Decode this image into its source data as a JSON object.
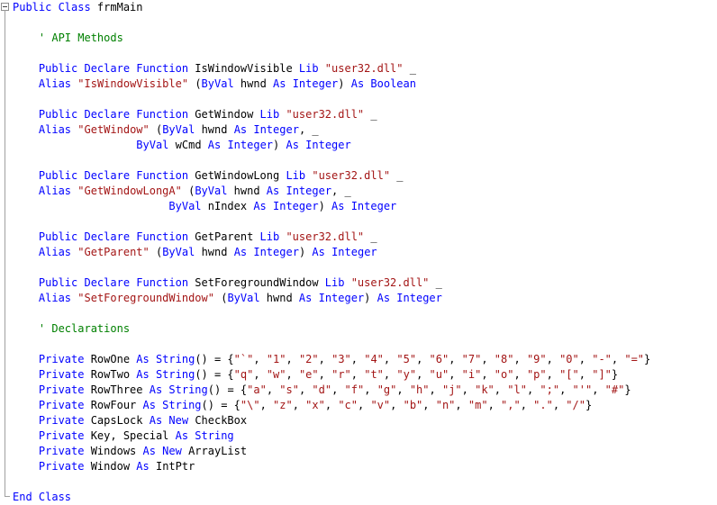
{
  "colors": {
    "keyword": "#0000ff",
    "string": "#a31515",
    "comment": "#008000",
    "plain": "#000000",
    "background": "#ffffff"
  },
  "lines": [
    [
      {
        "t": "kw",
        "v": "Public Class "
      },
      {
        "t": "p",
        "v": "frmMain"
      }
    ],
    [],
    [
      {
        "t": "p",
        "v": "    "
      },
      {
        "t": "cm",
        "v": "' API Methods"
      }
    ],
    [],
    [
      {
        "t": "p",
        "v": "    "
      },
      {
        "t": "kw",
        "v": "Public Declare Function "
      },
      {
        "t": "p",
        "v": "IsWindowVisible "
      },
      {
        "t": "kw",
        "v": "Lib "
      },
      {
        "t": "str",
        "v": "\"user32.dll\""
      },
      {
        "t": "p",
        "v": " _"
      }
    ],
    [
      {
        "t": "p",
        "v": "    "
      },
      {
        "t": "kw",
        "v": "Alias "
      },
      {
        "t": "str",
        "v": "\"IsWindowVisible\""
      },
      {
        "t": "p",
        "v": " ("
      },
      {
        "t": "kw",
        "v": "ByVal "
      },
      {
        "t": "p",
        "v": "hwnd "
      },
      {
        "t": "kw",
        "v": "As Integer"
      },
      {
        "t": "p",
        "v": ") "
      },
      {
        "t": "kw",
        "v": "As Boolean"
      }
    ],
    [],
    [
      {
        "t": "p",
        "v": "    "
      },
      {
        "t": "kw",
        "v": "Public Declare Function "
      },
      {
        "t": "p",
        "v": "GetWindow "
      },
      {
        "t": "kw",
        "v": "Lib "
      },
      {
        "t": "str",
        "v": "\"user32.dll\""
      },
      {
        "t": "p",
        "v": " _"
      }
    ],
    [
      {
        "t": "p",
        "v": "    "
      },
      {
        "t": "kw",
        "v": "Alias "
      },
      {
        "t": "str",
        "v": "\"GetWindow\""
      },
      {
        "t": "p",
        "v": " ("
      },
      {
        "t": "kw",
        "v": "ByVal "
      },
      {
        "t": "p",
        "v": "hwnd "
      },
      {
        "t": "kw",
        "v": "As Integer"
      },
      {
        "t": "p",
        "v": ", _"
      }
    ],
    [
      {
        "t": "p",
        "v": "                   "
      },
      {
        "t": "kw",
        "v": "ByVal "
      },
      {
        "t": "p",
        "v": "wCmd "
      },
      {
        "t": "kw",
        "v": "As Integer"
      },
      {
        "t": "p",
        "v": ") "
      },
      {
        "t": "kw",
        "v": "As Integer"
      }
    ],
    [],
    [
      {
        "t": "p",
        "v": "    "
      },
      {
        "t": "kw",
        "v": "Public Declare Function "
      },
      {
        "t": "p",
        "v": "GetWindowLong "
      },
      {
        "t": "kw",
        "v": "Lib "
      },
      {
        "t": "str",
        "v": "\"user32.dll\""
      },
      {
        "t": "p",
        "v": " _"
      }
    ],
    [
      {
        "t": "p",
        "v": "    "
      },
      {
        "t": "kw",
        "v": "Alias "
      },
      {
        "t": "str",
        "v": "\"GetWindowLongA\""
      },
      {
        "t": "p",
        "v": " ("
      },
      {
        "t": "kw",
        "v": "ByVal "
      },
      {
        "t": "p",
        "v": "hwnd "
      },
      {
        "t": "kw",
        "v": "As Integer"
      },
      {
        "t": "p",
        "v": ", _"
      }
    ],
    [
      {
        "t": "p",
        "v": "                        "
      },
      {
        "t": "kw",
        "v": "ByVal "
      },
      {
        "t": "p",
        "v": "nIndex "
      },
      {
        "t": "kw",
        "v": "As Integer"
      },
      {
        "t": "p",
        "v": ") "
      },
      {
        "t": "kw",
        "v": "As Integer"
      }
    ],
    [],
    [
      {
        "t": "p",
        "v": "    "
      },
      {
        "t": "kw",
        "v": "Public Declare Function "
      },
      {
        "t": "p",
        "v": "GetParent "
      },
      {
        "t": "kw",
        "v": "Lib "
      },
      {
        "t": "str",
        "v": "\"user32.dll\""
      },
      {
        "t": "p",
        "v": " _"
      }
    ],
    [
      {
        "t": "p",
        "v": "    "
      },
      {
        "t": "kw",
        "v": "Alias "
      },
      {
        "t": "str",
        "v": "\"GetParent\""
      },
      {
        "t": "p",
        "v": " ("
      },
      {
        "t": "kw",
        "v": "ByVal "
      },
      {
        "t": "p",
        "v": "hwnd "
      },
      {
        "t": "kw",
        "v": "As Integer"
      },
      {
        "t": "p",
        "v": ") "
      },
      {
        "t": "kw",
        "v": "As Integer"
      }
    ],
    [],
    [
      {
        "t": "p",
        "v": "    "
      },
      {
        "t": "kw",
        "v": "Public Declare Function "
      },
      {
        "t": "p",
        "v": "SetForegroundWindow "
      },
      {
        "t": "kw",
        "v": "Lib "
      },
      {
        "t": "str",
        "v": "\"user32.dll\""
      },
      {
        "t": "p",
        "v": " _"
      }
    ],
    [
      {
        "t": "p",
        "v": "    "
      },
      {
        "t": "kw",
        "v": "Alias "
      },
      {
        "t": "str",
        "v": "\"SetForegroundWindow\""
      },
      {
        "t": "p",
        "v": " ("
      },
      {
        "t": "kw",
        "v": "ByVal "
      },
      {
        "t": "p",
        "v": "hwnd "
      },
      {
        "t": "kw",
        "v": "As Integer"
      },
      {
        "t": "p",
        "v": ") "
      },
      {
        "t": "kw",
        "v": "As Integer"
      }
    ],
    [],
    [
      {
        "t": "p",
        "v": "    "
      },
      {
        "t": "cm",
        "v": "' Declarations"
      }
    ],
    [],
    [
      {
        "t": "p",
        "v": "    "
      },
      {
        "t": "kw",
        "v": "Private "
      },
      {
        "t": "p",
        "v": "RowOne "
      },
      {
        "t": "kw",
        "v": "As String"
      },
      {
        "t": "p",
        "v": "() = {"
      },
      {
        "t": "str",
        "v": "\"`\""
      },
      {
        "t": "p",
        "v": ", "
      },
      {
        "t": "str",
        "v": "\"1\""
      },
      {
        "t": "p",
        "v": ", "
      },
      {
        "t": "str",
        "v": "\"2\""
      },
      {
        "t": "p",
        "v": ", "
      },
      {
        "t": "str",
        "v": "\"3\""
      },
      {
        "t": "p",
        "v": ", "
      },
      {
        "t": "str",
        "v": "\"4\""
      },
      {
        "t": "p",
        "v": ", "
      },
      {
        "t": "str",
        "v": "\"5\""
      },
      {
        "t": "p",
        "v": ", "
      },
      {
        "t": "str",
        "v": "\"6\""
      },
      {
        "t": "p",
        "v": ", "
      },
      {
        "t": "str",
        "v": "\"7\""
      },
      {
        "t": "p",
        "v": ", "
      },
      {
        "t": "str",
        "v": "\"8\""
      },
      {
        "t": "p",
        "v": ", "
      },
      {
        "t": "str",
        "v": "\"9\""
      },
      {
        "t": "p",
        "v": ", "
      },
      {
        "t": "str",
        "v": "\"0\""
      },
      {
        "t": "p",
        "v": ", "
      },
      {
        "t": "str",
        "v": "\"-\""
      },
      {
        "t": "p",
        "v": ", "
      },
      {
        "t": "str",
        "v": "\"=\""
      },
      {
        "t": "p",
        "v": "}"
      }
    ],
    [
      {
        "t": "p",
        "v": "    "
      },
      {
        "t": "kw",
        "v": "Private "
      },
      {
        "t": "p",
        "v": "RowTwo "
      },
      {
        "t": "kw",
        "v": "As String"
      },
      {
        "t": "p",
        "v": "() = {"
      },
      {
        "t": "str",
        "v": "\"q\""
      },
      {
        "t": "p",
        "v": ", "
      },
      {
        "t": "str",
        "v": "\"w\""
      },
      {
        "t": "p",
        "v": ", "
      },
      {
        "t": "str",
        "v": "\"e\""
      },
      {
        "t": "p",
        "v": ", "
      },
      {
        "t": "str",
        "v": "\"r\""
      },
      {
        "t": "p",
        "v": ", "
      },
      {
        "t": "str",
        "v": "\"t\""
      },
      {
        "t": "p",
        "v": ", "
      },
      {
        "t": "str",
        "v": "\"y\""
      },
      {
        "t": "p",
        "v": ", "
      },
      {
        "t": "str",
        "v": "\"u\""
      },
      {
        "t": "p",
        "v": ", "
      },
      {
        "t": "str",
        "v": "\"i\""
      },
      {
        "t": "p",
        "v": ", "
      },
      {
        "t": "str",
        "v": "\"o\""
      },
      {
        "t": "p",
        "v": ", "
      },
      {
        "t": "str",
        "v": "\"p\""
      },
      {
        "t": "p",
        "v": ", "
      },
      {
        "t": "str",
        "v": "\"[\""
      },
      {
        "t": "p",
        "v": ", "
      },
      {
        "t": "str",
        "v": "\"]\""
      },
      {
        "t": "p",
        "v": "}"
      }
    ],
    [
      {
        "t": "p",
        "v": "    "
      },
      {
        "t": "kw",
        "v": "Private "
      },
      {
        "t": "p",
        "v": "RowThree "
      },
      {
        "t": "kw",
        "v": "As String"
      },
      {
        "t": "p",
        "v": "() = {"
      },
      {
        "t": "str",
        "v": "\"a\""
      },
      {
        "t": "p",
        "v": ", "
      },
      {
        "t": "str",
        "v": "\"s\""
      },
      {
        "t": "p",
        "v": ", "
      },
      {
        "t": "str",
        "v": "\"d\""
      },
      {
        "t": "p",
        "v": ", "
      },
      {
        "t": "str",
        "v": "\"f\""
      },
      {
        "t": "p",
        "v": ", "
      },
      {
        "t": "str",
        "v": "\"g\""
      },
      {
        "t": "p",
        "v": ", "
      },
      {
        "t": "str",
        "v": "\"h\""
      },
      {
        "t": "p",
        "v": ", "
      },
      {
        "t": "str",
        "v": "\"j\""
      },
      {
        "t": "p",
        "v": ", "
      },
      {
        "t": "str",
        "v": "\"k\""
      },
      {
        "t": "p",
        "v": ", "
      },
      {
        "t": "str",
        "v": "\"l\""
      },
      {
        "t": "p",
        "v": ", "
      },
      {
        "t": "str",
        "v": "\";\""
      },
      {
        "t": "p",
        "v": ", "
      },
      {
        "t": "str",
        "v": "\"'\""
      },
      {
        "t": "p",
        "v": ", "
      },
      {
        "t": "str",
        "v": "\"#\""
      },
      {
        "t": "p",
        "v": "}"
      }
    ],
    [
      {
        "t": "p",
        "v": "    "
      },
      {
        "t": "kw",
        "v": "Private "
      },
      {
        "t": "p",
        "v": "RowFour "
      },
      {
        "t": "kw",
        "v": "As String"
      },
      {
        "t": "p",
        "v": "() = {"
      },
      {
        "t": "str",
        "v": "\"\\\""
      },
      {
        "t": "p",
        "v": ", "
      },
      {
        "t": "str",
        "v": "\"z\""
      },
      {
        "t": "p",
        "v": ", "
      },
      {
        "t": "str",
        "v": "\"x\""
      },
      {
        "t": "p",
        "v": ", "
      },
      {
        "t": "str",
        "v": "\"c\""
      },
      {
        "t": "p",
        "v": ", "
      },
      {
        "t": "str",
        "v": "\"v\""
      },
      {
        "t": "p",
        "v": ", "
      },
      {
        "t": "str",
        "v": "\"b\""
      },
      {
        "t": "p",
        "v": ", "
      },
      {
        "t": "str",
        "v": "\"n\""
      },
      {
        "t": "p",
        "v": ", "
      },
      {
        "t": "str",
        "v": "\"m\""
      },
      {
        "t": "p",
        "v": ", "
      },
      {
        "t": "str",
        "v": "\",\""
      },
      {
        "t": "p",
        "v": ", "
      },
      {
        "t": "str",
        "v": "\".\""
      },
      {
        "t": "p",
        "v": ", "
      },
      {
        "t": "str",
        "v": "\"/\""
      },
      {
        "t": "p",
        "v": "}"
      }
    ],
    [
      {
        "t": "p",
        "v": "    "
      },
      {
        "t": "kw",
        "v": "Private "
      },
      {
        "t": "p",
        "v": "CapsLock "
      },
      {
        "t": "kw",
        "v": "As New "
      },
      {
        "t": "p",
        "v": "CheckBox"
      }
    ],
    [
      {
        "t": "p",
        "v": "    "
      },
      {
        "t": "kw",
        "v": "Private "
      },
      {
        "t": "p",
        "v": "Key, Special "
      },
      {
        "t": "kw",
        "v": "As String"
      }
    ],
    [
      {
        "t": "p",
        "v": "    "
      },
      {
        "t": "kw",
        "v": "Private "
      },
      {
        "t": "p",
        "v": "Windows "
      },
      {
        "t": "kw",
        "v": "As New "
      },
      {
        "t": "p",
        "v": "ArrayList"
      }
    ],
    [
      {
        "t": "p",
        "v": "    "
      },
      {
        "t": "kw",
        "v": "Private "
      },
      {
        "t": "p",
        "v": "Window "
      },
      {
        "t": "kw",
        "v": "As "
      },
      {
        "t": "p",
        "v": "IntPtr"
      }
    ],
    [],
    [
      {
        "t": "kw",
        "v": "End Class"
      }
    ]
  ]
}
